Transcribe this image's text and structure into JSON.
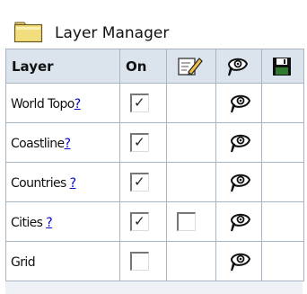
{
  "title": "Layer Manager",
  "columns": {
    "layer": "Layer",
    "on": "On"
  },
  "icons": {
    "folder": "folder-icon",
    "edit": "pencil-edit-icon",
    "visibility": "eye-icon",
    "save": "floppy-disk-icon",
    "checkmark": "✓"
  },
  "colors": {
    "header_bg": "#dbe3ec",
    "grid": "#a8b4c2",
    "link": "#0000cc"
  },
  "rows": [
    {
      "name": "World Topo",
      "help": "?",
      "on": true,
      "edit": null,
      "visible": true
    },
    {
      "name": "Coastline",
      "help": "?",
      "on": true,
      "edit": null,
      "visible": true
    },
    {
      "name": "Countries ",
      "help": "?",
      "on": true,
      "edit": null,
      "visible": true
    },
    {
      "name": "Cities ",
      "help": "?",
      "on": true,
      "edit": false,
      "visible": true
    },
    {
      "name": "Grid",
      "help": "",
      "on": false,
      "edit": null,
      "visible": true
    }
  ]
}
